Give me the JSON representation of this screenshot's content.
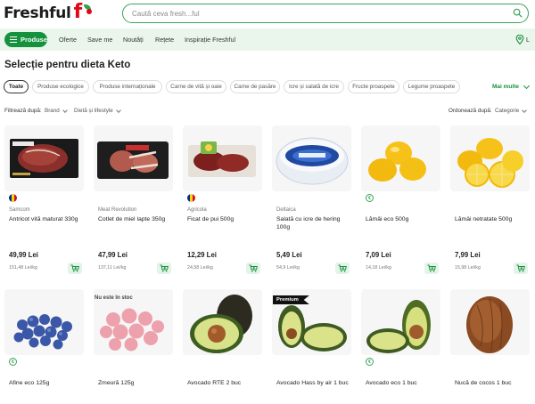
{
  "header": {
    "logo_text": "Freshful",
    "search_placeholder": "Caută ceva fresh...ful"
  },
  "nav": {
    "produse": "Produse",
    "items": [
      "Oferte",
      "Save me",
      "Noutăți",
      "Rețete",
      "Inspirație Freshful"
    ],
    "cut_text": "L"
  },
  "page": {
    "title": "Selecție pentru dieta Keto"
  },
  "chips": [
    "Toate",
    "Produse ecologice",
    "Produse internaționale",
    "Carne de vită și oaie",
    "Carne de pasăre",
    "Icre și salată de icre",
    "Fructe proaspete",
    "Legume proaspete"
  ],
  "mai_multe": "Mai multe",
  "filters": {
    "filter_label": "Filtrează după:",
    "brand": "Brand",
    "diet": "Dietă și lifestyle",
    "sort_label": "Ordonează după:",
    "sort_value": "Categorie"
  },
  "products": [
    {
      "brand": "Samcom",
      "name": "Antricot vită maturat 330g",
      "price": "49,99 Lei",
      "unit": "151,48 Lei/kg",
      "badge": "flag"
    },
    {
      "brand": "Meat Revolution",
      "name": "Cotlet de miel lapte 350g",
      "price": "47,99 Lei",
      "unit": "137,11 Lei/kg",
      "badge": "none"
    },
    {
      "brand": "Agricola",
      "name": "Ficat de pui 500g",
      "price": "12,29 Lei",
      "unit": "24,58 Lei/kg",
      "badge": "flag"
    },
    {
      "brand": "Deltaica",
      "name": "Salată cu icre de hering 100g",
      "price": "5,49 Lei",
      "unit": "54,9 Lei/kg",
      "badge": "none"
    },
    {
      "brand": "",
      "name": "Lămâi eco 500g",
      "price": "7,09 Lei",
      "unit": "14,18 Lei/kg",
      "badge": "eco"
    },
    {
      "brand": "",
      "name": "Lămâi netratate 500g",
      "price": "7,99 Lei",
      "unit": "15,98 Lei/kg",
      "badge": "none"
    },
    {
      "name": "Afine eco 125g",
      "badge": "eco"
    },
    {
      "name": "Zmeură 125g",
      "badge": "none"
    },
    {
      "name": "Avocado RTE 2 buc",
      "badge": "none"
    },
    {
      "name": "Avocado Hass by air 1 buc",
      "badge": "none"
    },
    {
      "name": "Avocado eco 1 buc",
      "badge": "eco"
    },
    {
      "name": "Nucă de cocos 1 buc",
      "badge": "none"
    }
  ],
  "tags": {
    "out_of_stock": "Nu este în stoc",
    "premium": "Premium"
  },
  "colors": {
    "brand_green": "#16923e",
    "brand_red": "#e30613",
    "nav_bg": "#eaf6ec"
  }
}
